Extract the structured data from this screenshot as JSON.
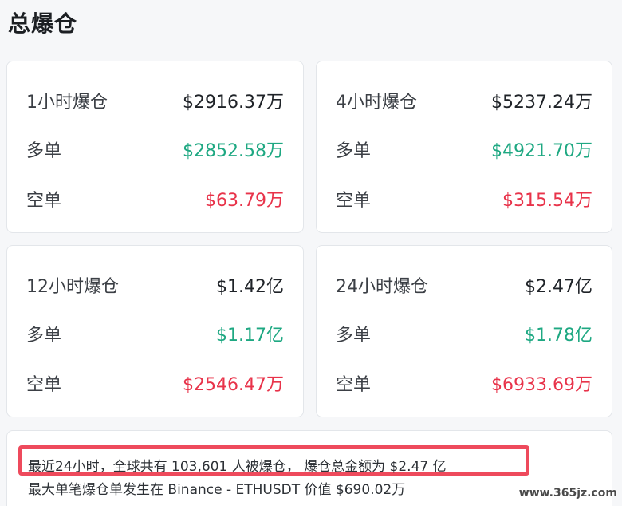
{
  "page_title": "总爆仓",
  "cards": [
    {
      "total_label": "1小时爆仓",
      "total_value": "$2916.37万",
      "long_label": "多单",
      "long_value": "$2852.58万",
      "short_label": "空单",
      "short_value": "$63.79万"
    },
    {
      "total_label": "4小时爆仓",
      "total_value": "$5237.24万",
      "long_label": "多单",
      "long_value": "$4921.70万",
      "short_label": "空单",
      "short_value": "$315.54万"
    },
    {
      "total_label": "12小时爆仓",
      "total_value": "$1.42亿",
      "long_label": "多单",
      "long_value": "$1.17亿",
      "short_label": "空单",
      "short_value": "$2546.47万"
    },
    {
      "total_label": "24小时爆仓",
      "total_value": "$2.47亿",
      "long_label": "多单",
      "long_value": "$1.78亿",
      "short_label": "空单",
      "short_value": "$6933.69万"
    }
  ],
  "summary": {
    "line1": "最近24小时，全球共有 103,601 人被爆仓， 爆仓总金额为 $2.47 亿",
    "line2": "最大单笔爆仓单发生在 Binance - ETHUSDT 价值 $690.02万"
  },
  "colors": {
    "long": "#1ea882",
    "short": "#e8334a",
    "highlight": "#ee4a5c"
  },
  "watermark": "www.365jz.com"
}
